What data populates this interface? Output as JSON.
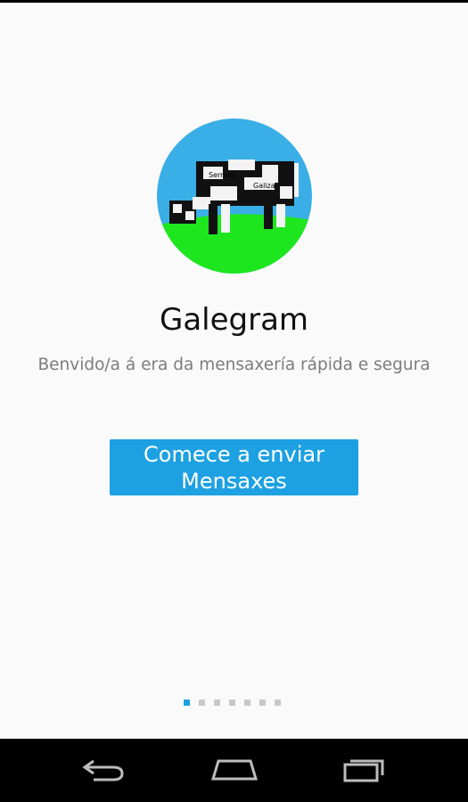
{
  "app": {
    "title": "Galegram",
    "subtitle": "Benvido/a á era da mensaxería rápida e segura",
    "logo": {
      "icon": "cow-logo-icon",
      "text_top": "Sermos",
      "text_bottom": "Galiza"
    }
  },
  "start_button": {
    "label": "Comece a enviar Mensaxes"
  },
  "pager": {
    "total": 7,
    "active_index": 0
  },
  "nav_bar": {
    "back_icon": "back-icon",
    "home_icon": "home-icon",
    "recents_icon": "recents-icon"
  },
  "colors": {
    "accent": "#1da1e2",
    "background": "#fafafa",
    "nav_bar": "#000000"
  }
}
